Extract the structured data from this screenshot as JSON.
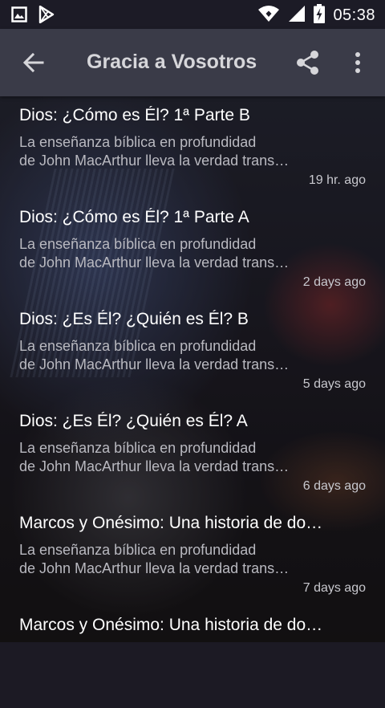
{
  "status_bar": {
    "time": "05:38",
    "icons": [
      "image-notification-icon",
      "play-store-icon",
      "wifi-icon",
      "signal-icon",
      "battery-charging-icon"
    ]
  },
  "toolbar": {
    "title": "Gracia a Vosotros",
    "icons": [
      "back-arrow-icon",
      "share-icon",
      "more-vert-icon"
    ]
  },
  "episodes": [
    {
      "title": "Dios: ¿Cómo es Él? 1ª Parte B",
      "desc_line1": "La enseñanza bíblica en profundidad",
      "desc_line2": "de John MacArthur lleva la verdad trans…",
      "time": "19 hr. ago"
    },
    {
      "title": "Dios: ¿Cómo es Él? 1ª Parte A",
      "desc_line1": "La enseñanza bíblica en profundidad",
      "desc_line2": "de John MacArthur lleva la verdad trans…",
      "time": "2 days ago"
    },
    {
      "title": "Dios: ¿Es Él? ¿Quién es Él?  B",
      "desc_line1": "La enseñanza bíblica en profundidad",
      "desc_line2": "de John MacArthur lleva la verdad trans…",
      "time": "5 days ago"
    },
    {
      "title": "Dios: ¿Es Él? ¿Quién es Él?  A",
      "desc_line1": "La enseñanza bíblica en profundidad",
      "desc_line2": "de John MacArthur lleva la verdad trans…",
      "time": "6 days ago"
    },
    {
      "title": "Marcos y Onésimo: Una historia de do…",
      "desc_line1": "La enseñanza bíblica en profundidad",
      "desc_line2": "de John MacArthur lleva la verdad trans…",
      "time": "7 days ago"
    },
    {
      "title": "Marcos y Onésimo: Una historia de do…",
      "desc_line1": "",
      "desc_line2": "",
      "time": ""
    }
  ]
}
